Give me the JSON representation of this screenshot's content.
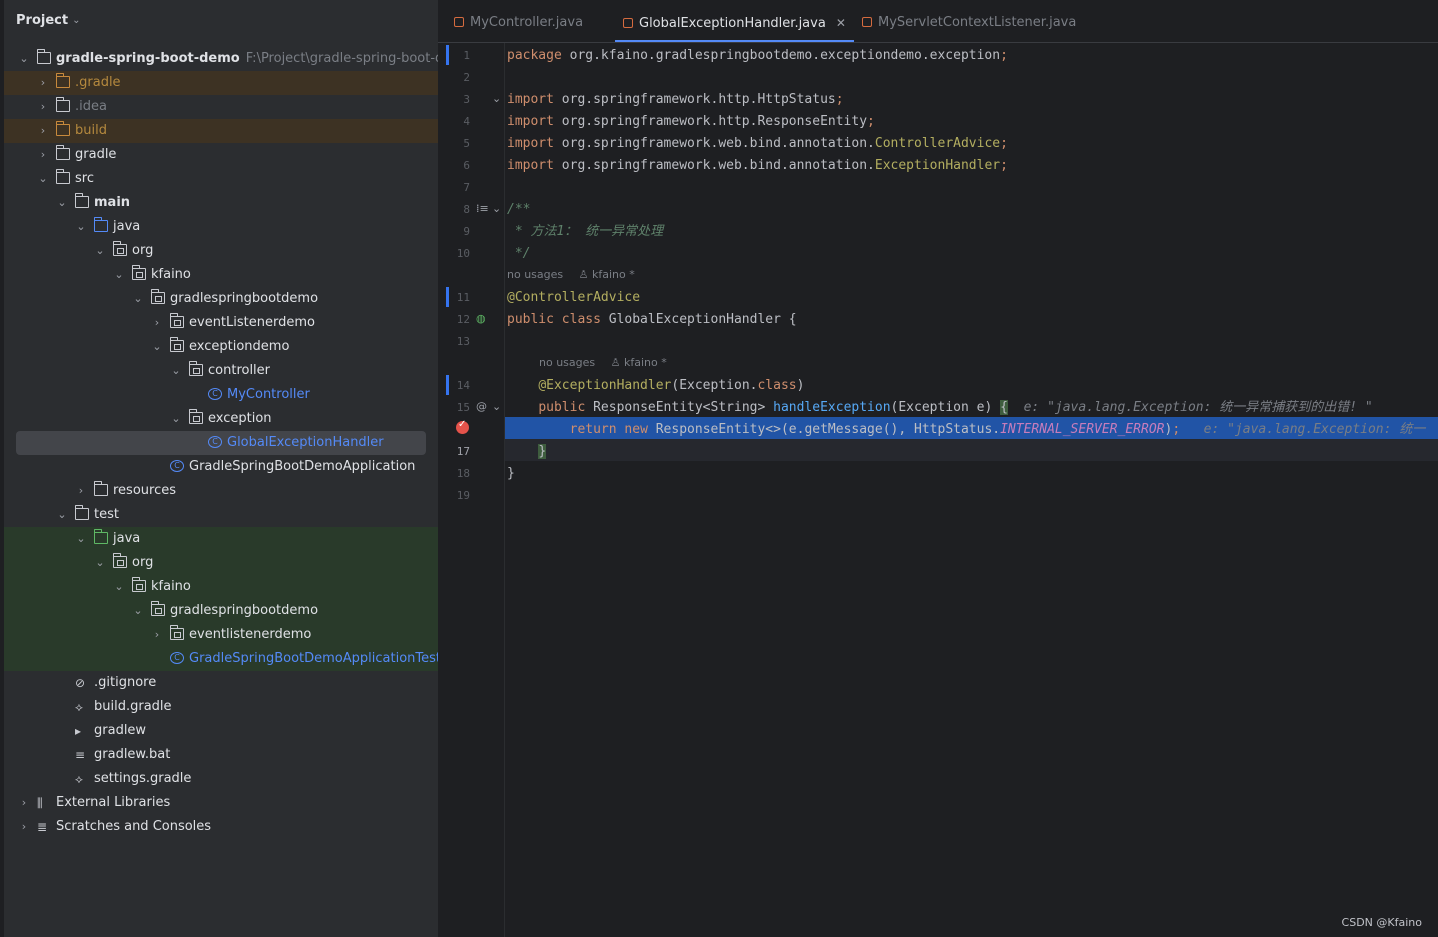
{
  "project_panel": {
    "title": "Project",
    "tree": [
      {
        "label": "gradle-spring-boot-demo",
        "path": "F:\\Project\\gradle-spring-boot-dem",
        "depth": 0,
        "arrow": "v",
        "icon": "module-folder",
        "bold": true
      },
      {
        "label": ".gradle",
        "depth": 1,
        "arrow": ">",
        "icon": "folder-orange",
        "style": "ignored",
        "bg": "ignored"
      },
      {
        "label": ".idea",
        "depth": 1,
        "arrow": ">",
        "icon": "folder",
        "style": "idea"
      },
      {
        "label": "build",
        "depth": 1,
        "arrow": ">",
        "icon": "folder-orange",
        "style": "ignored",
        "bg": "ignored"
      },
      {
        "label": "gradle",
        "depth": 1,
        "arrow": ">",
        "icon": "folder"
      },
      {
        "label": "src",
        "depth": 1,
        "arrow": "v",
        "icon": "folder"
      },
      {
        "label": "main",
        "depth": 2,
        "arrow": "v",
        "icon": "module-folder",
        "bold": true
      },
      {
        "label": "java",
        "depth": 3,
        "arrow": "v",
        "icon": "folder-blue"
      },
      {
        "label": "org",
        "depth": 4,
        "arrow": "v",
        "icon": "package"
      },
      {
        "label": "kfaino",
        "depth": 5,
        "arrow": "v",
        "icon": "package"
      },
      {
        "label": "gradlespringbootdemo",
        "depth": 6,
        "arrow": "v",
        "icon": "package"
      },
      {
        "label": "eventListenerdemo",
        "depth": 7,
        "arrow": ">",
        "icon": "package"
      },
      {
        "label": "exceptiondemo",
        "depth": 7,
        "arrow": "v",
        "icon": "package"
      },
      {
        "label": "controller",
        "depth": 8,
        "arrow": "v",
        "icon": "package"
      },
      {
        "label": "MyController",
        "depth": 9,
        "arrow": "",
        "icon": "class",
        "style": "cls"
      },
      {
        "label": "exception",
        "depth": 8,
        "arrow": "v",
        "icon": "package"
      },
      {
        "label": "GlobalExceptionHandler",
        "depth": 9,
        "arrow": "",
        "icon": "class",
        "style": "cls",
        "selected": true
      },
      {
        "label": "GradleSpringBootDemoApplication",
        "depth": 7,
        "arrow": "",
        "icon": "class-app"
      },
      {
        "label": "resources",
        "depth": 3,
        "arrow": ">",
        "icon": "resources"
      },
      {
        "label": "test",
        "depth": 2,
        "arrow": "v",
        "icon": "module-folder"
      },
      {
        "label": "java",
        "depth": 3,
        "arrow": "v",
        "icon": "folder-green",
        "bg": "test"
      },
      {
        "label": "org",
        "depth": 4,
        "arrow": "v",
        "icon": "package",
        "bg": "test"
      },
      {
        "label": "kfaino",
        "depth": 5,
        "arrow": "v",
        "icon": "package",
        "bg": "test"
      },
      {
        "label": "gradlespringbootdemo",
        "depth": 6,
        "arrow": "v",
        "icon": "package",
        "bg": "test"
      },
      {
        "label": "eventlistenerdemo",
        "depth": 7,
        "arrow": ">",
        "icon": "package",
        "bg": "test"
      },
      {
        "label": "GradleSpringBootDemoApplicationTests",
        "depth": 7,
        "arrow": "",
        "icon": "class",
        "style": "cls",
        "bg": "test"
      },
      {
        "label": ".gitignore",
        "depth": 2,
        "arrow": "",
        "icon": "ignore-file"
      },
      {
        "label": "build.gradle",
        "depth": 2,
        "arrow": "",
        "icon": "gradle-file"
      },
      {
        "label": "gradlew",
        "depth": 2,
        "arrow": "",
        "icon": "script-file"
      },
      {
        "label": "gradlew.bat",
        "depth": 2,
        "arrow": "",
        "icon": "text-file"
      },
      {
        "label": "settings.gradle",
        "depth": 2,
        "arrow": "",
        "icon": "gradle-file"
      },
      {
        "label": "External Libraries",
        "depth": 0,
        "arrow": ">",
        "icon": "libraries"
      },
      {
        "label": "Scratches and Consoles",
        "depth": 0,
        "arrow": ">",
        "icon": "scratches"
      }
    ]
  },
  "tabs": [
    {
      "label": "MyController.java",
      "active": false
    },
    {
      "label": "GlobalExceptionHandler.java",
      "active": true
    },
    {
      "label": "MyServletContextListener.java",
      "active": false
    }
  ],
  "editor": {
    "lines": [
      {
        "n": "1",
        "html": "<span class=\"kw\">package</span> org.kfaino.gradlespringbootdemo.exceptiondemo.exception<span class=\"kw\">;</span>"
      },
      {
        "n": "2",
        "html": ""
      },
      {
        "n": "3",
        "html": "<span class=\"kw\">import</span> org.springframework.http.HttpStatus<span class=\"kw\">;</span>"
      },
      {
        "n": "4",
        "html": "<span class=\"kw\">import</span> org.springframework.http.ResponseEntity<span class=\"kw\">;</span>"
      },
      {
        "n": "5",
        "html": "<span class=\"kw\">import</span> org.springframework.web.bind.annotation.<span class=\"cls-y\">ControllerAdvice</span><span class=\"kw\">;</span>"
      },
      {
        "n": "6",
        "html": "<span class=\"kw\">import</span> org.springframework.web.bind.annotation.<span class=\"cls-y\">ExceptionHandler</span><span class=\"kw\">;</span>"
      },
      {
        "n": "7",
        "html": ""
      },
      {
        "n": "8",
        "html": "<span class=\"cmt\">/**</span>"
      },
      {
        "n": "9",
        "html": "<span class=\"cmt\"> * 方法1： 统一异常处理</span>"
      },
      {
        "n": "10",
        "html": "<span class=\"cmt\"> */</span>"
      },
      {
        "n": "11",
        "html": "<span class=\"ann\">@ControllerAdvice</span>"
      },
      {
        "n": "12",
        "html": "<span class=\"kw\">public class</span> GlobalExceptionHandler {"
      },
      {
        "n": "13",
        "html": ""
      },
      {
        "n": "14",
        "html": "    <span class=\"ann\">@ExceptionHandler</span>(Exception.<span class=\"kw\">class</span>)"
      },
      {
        "n": "15",
        "html": "    <span class=\"kw\">public</span> ResponseEntity&lt;String&gt; <span class=\"fn\">handleException</span>(Exception e) <span class=\"caret-bracket\">{</span>  <span class=\"hint\">e: \"java.lang.Exception: 统一异常捕获到的出错! \"</span>"
      },
      {
        "n": "",
        "html": "        <span class=\"kw\">return new</span> ResponseEntity&lt;&gt;(e.getMessage(), HttpStatus.<span class=\"const\">INTERNAL_SERVER_ERROR</span>)<span class=\"kw\">;</span>   <span class=\"hint\">e: \"java.lang.Exception: 统一</span>"
      },
      {
        "n": "17",
        "html": "    <span class=\"caret-bracket\">}</span>"
      },
      {
        "n": "18",
        "html": "}"
      },
      {
        "n": "19",
        "html": ""
      }
    ],
    "inlay_usage_1": "no usages",
    "inlay_author_1": "kfaino *",
    "inlay_usage_2": "no usages",
    "inlay_author_2": "kfaino *"
  },
  "watermark": "CSDN @Kfaino"
}
